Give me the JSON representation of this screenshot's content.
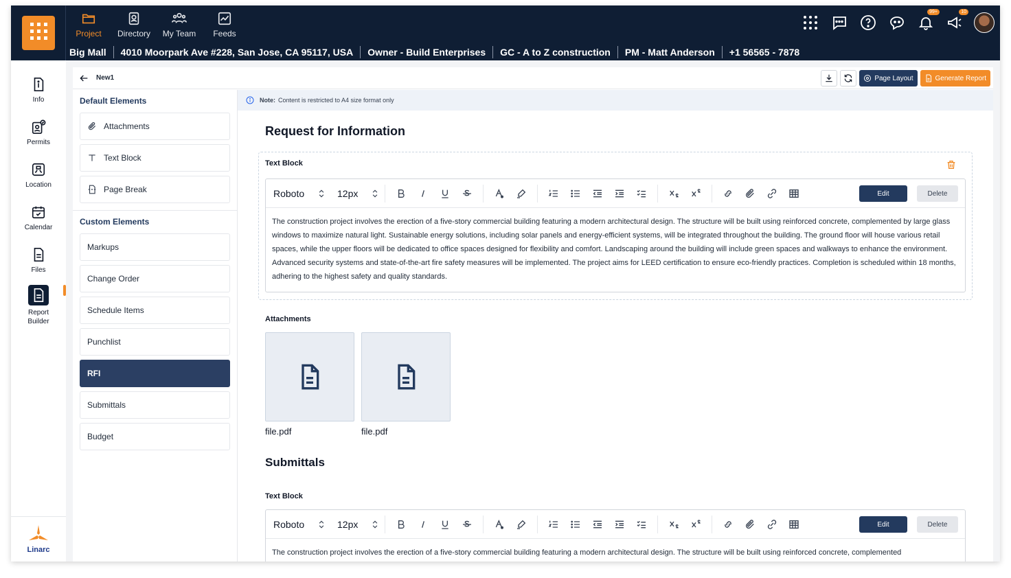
{
  "nav": {
    "tabs": [
      {
        "label": "Project",
        "icon": "folder-icon"
      },
      {
        "label": "Directory",
        "icon": "contact-card-icon"
      },
      {
        "label": "My Team",
        "icon": "team-icon"
      },
      {
        "label": "Feeds",
        "icon": "chart-icon"
      }
    ],
    "active_tab": "Project"
  },
  "project_info": {
    "name": "Big Mall",
    "address": "4010 Moorpark Ave #228, San Jose, CA 95117, USA",
    "owner": "Owner - Build Enterprises",
    "gc": "GC - A to Z construction",
    "pm": "PM -  Matt Anderson",
    "phone": "+1 56565 - 7878"
  },
  "header_icons": {
    "notifications_badge": "99+",
    "announcements_badge": "10"
  },
  "rail": {
    "items": [
      {
        "label": "Info"
      },
      {
        "label": "Permits"
      },
      {
        "label": "Location"
      },
      {
        "label": "Calendar"
      },
      {
        "label": "Files"
      },
      {
        "label": "Report Builder"
      }
    ],
    "brand": "Linarc"
  },
  "subheader": {
    "title": "New1",
    "page_layout": "Page Layout",
    "generate_report": "Generate Report"
  },
  "elements": {
    "default_title": "Default Elements",
    "default_items": [
      "Attachments",
      "Text Block",
      "Page Break"
    ],
    "custom_title": "Custom Elements",
    "custom_items": [
      "Markups",
      "Change Order",
      "Schedule Items",
      "Punchlist",
      "RFI",
      "Submittals",
      "Budget"
    ],
    "active": "RFI"
  },
  "note": {
    "bold": "Note:",
    "text": "Content is restricted to A4 size format only"
  },
  "canvas": {
    "section1_title": "Request for Information",
    "text_block_label": "Text Block",
    "font": "Roboto",
    "size": "12px",
    "edit": "Edit",
    "delete": "Delete",
    "body": "The construction project involves the erection of a five-story commercial building featuring a modern architectural design. The structure will be built using reinforced concrete, complemented by large glass windows to maximize natural light. Sustainable energy solutions, including solar panels and energy-efficient systems, will be integrated throughout the building. The ground floor will house various retail spaces, while the upper floors will be dedicated to office spaces designed for flexibility and comfort. Landscaping around the building will include green spaces and walkways to enhance the environment. Advanced security systems and state-of-the-art fire safety measures will be implemented. The project aims for LEED certification to ensure eco-friendly practices. Completion is scheduled within 18 months, adhering to the highest safety and quality standards.",
    "body_preview": "The construction project involves the erection of a five-story commercial building featuring a modern architectural design. The structure will be built using reinforced concrete, complemented",
    "attachments_label": "Attachments",
    "files": [
      "file.pdf",
      "file.pdf"
    ],
    "section2_title": "Submittals"
  },
  "colors": {
    "navy": "#0f1e34",
    "accent": "#f28c28",
    "button": "#233a5e"
  }
}
